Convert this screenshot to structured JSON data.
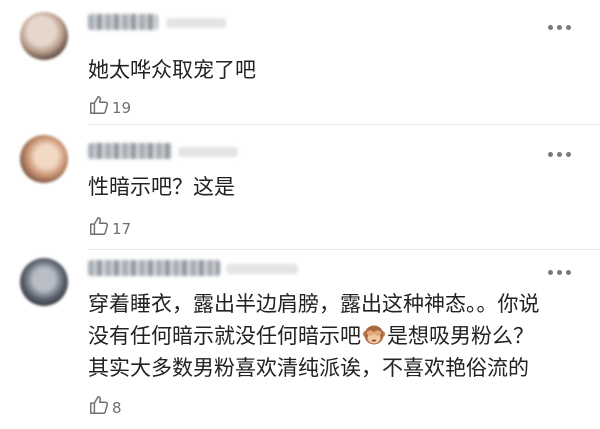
{
  "comments": [
    {
      "text": "她太哗众取宠了吧",
      "likes": "19"
    },
    {
      "text": "性暗示吧？这是",
      "likes": "17"
    },
    {
      "text_line1": "穿着睡衣，露出半边肩膀，露出这种神态。。你说",
      "text_line2_a": "没有任何暗示就没任何暗示吧",
      "text_line2_b": "是想吸男粉么？",
      "text_line3": "其实大多数男粉喜欢清纯派诶，不喜欢艳俗流的",
      "likes": "8"
    }
  ],
  "icons": {
    "like": "thumbs-up-icon",
    "more": "more-dots-icon",
    "emoji": "see-no-evil-monkey-emoji"
  },
  "colors": {
    "text": "#222222",
    "muted": "#6f6f6f",
    "divider": "#ececec"
  }
}
